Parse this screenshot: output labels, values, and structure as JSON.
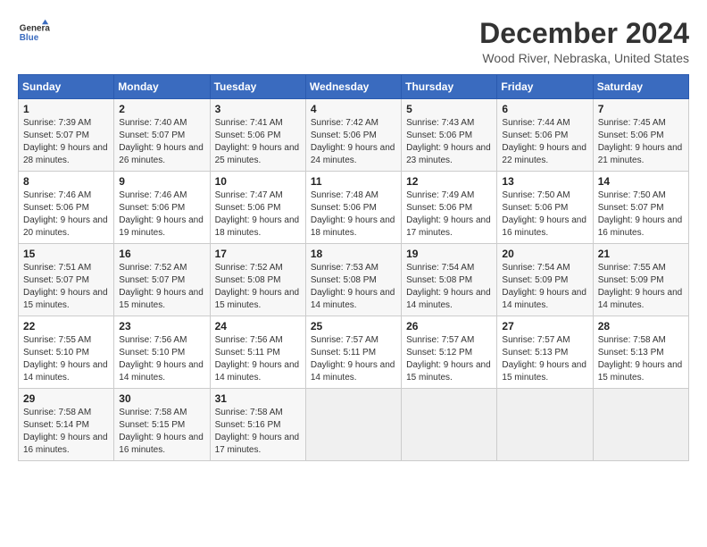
{
  "header": {
    "logo_line1": "General",
    "logo_line2": "Blue",
    "month": "December 2024",
    "location": "Wood River, Nebraska, United States"
  },
  "days_of_week": [
    "Sunday",
    "Monday",
    "Tuesday",
    "Wednesday",
    "Thursday",
    "Friday",
    "Saturday"
  ],
  "weeks": [
    [
      {
        "day": "1",
        "sunrise": "7:39 AM",
        "sunset": "5:07 PM",
        "daylight": "9 hours and 28 minutes."
      },
      {
        "day": "2",
        "sunrise": "7:40 AM",
        "sunset": "5:07 PM",
        "daylight": "9 hours and 26 minutes."
      },
      {
        "day": "3",
        "sunrise": "7:41 AM",
        "sunset": "5:06 PM",
        "daylight": "9 hours and 25 minutes."
      },
      {
        "day": "4",
        "sunrise": "7:42 AM",
        "sunset": "5:06 PM",
        "daylight": "9 hours and 24 minutes."
      },
      {
        "day": "5",
        "sunrise": "7:43 AM",
        "sunset": "5:06 PM",
        "daylight": "9 hours and 23 minutes."
      },
      {
        "day": "6",
        "sunrise": "7:44 AM",
        "sunset": "5:06 PM",
        "daylight": "9 hours and 22 minutes."
      },
      {
        "day": "7",
        "sunrise": "7:45 AM",
        "sunset": "5:06 PM",
        "daylight": "9 hours and 21 minutes."
      }
    ],
    [
      {
        "day": "8",
        "sunrise": "7:46 AM",
        "sunset": "5:06 PM",
        "daylight": "9 hours and 20 minutes."
      },
      {
        "day": "9",
        "sunrise": "7:46 AM",
        "sunset": "5:06 PM",
        "daylight": "9 hours and 19 minutes."
      },
      {
        "day": "10",
        "sunrise": "7:47 AM",
        "sunset": "5:06 PM",
        "daylight": "9 hours and 18 minutes."
      },
      {
        "day": "11",
        "sunrise": "7:48 AM",
        "sunset": "5:06 PM",
        "daylight": "9 hours and 18 minutes."
      },
      {
        "day": "12",
        "sunrise": "7:49 AM",
        "sunset": "5:06 PM",
        "daylight": "9 hours and 17 minutes."
      },
      {
        "day": "13",
        "sunrise": "7:50 AM",
        "sunset": "5:06 PM",
        "daylight": "9 hours and 16 minutes."
      },
      {
        "day": "14",
        "sunrise": "7:50 AM",
        "sunset": "5:07 PM",
        "daylight": "9 hours and 16 minutes."
      }
    ],
    [
      {
        "day": "15",
        "sunrise": "7:51 AM",
        "sunset": "5:07 PM",
        "daylight": "9 hours and 15 minutes."
      },
      {
        "day": "16",
        "sunrise": "7:52 AM",
        "sunset": "5:07 PM",
        "daylight": "9 hours and 15 minutes."
      },
      {
        "day": "17",
        "sunrise": "7:52 AM",
        "sunset": "5:08 PM",
        "daylight": "9 hours and 15 minutes."
      },
      {
        "day": "18",
        "sunrise": "7:53 AM",
        "sunset": "5:08 PM",
        "daylight": "9 hours and 14 minutes."
      },
      {
        "day": "19",
        "sunrise": "7:54 AM",
        "sunset": "5:08 PM",
        "daylight": "9 hours and 14 minutes."
      },
      {
        "day": "20",
        "sunrise": "7:54 AM",
        "sunset": "5:09 PM",
        "daylight": "9 hours and 14 minutes."
      },
      {
        "day": "21",
        "sunrise": "7:55 AM",
        "sunset": "5:09 PM",
        "daylight": "9 hours and 14 minutes."
      }
    ],
    [
      {
        "day": "22",
        "sunrise": "7:55 AM",
        "sunset": "5:10 PM",
        "daylight": "9 hours and 14 minutes."
      },
      {
        "day": "23",
        "sunrise": "7:56 AM",
        "sunset": "5:10 PM",
        "daylight": "9 hours and 14 minutes."
      },
      {
        "day": "24",
        "sunrise": "7:56 AM",
        "sunset": "5:11 PM",
        "daylight": "9 hours and 14 minutes."
      },
      {
        "day": "25",
        "sunrise": "7:57 AM",
        "sunset": "5:11 PM",
        "daylight": "9 hours and 14 minutes."
      },
      {
        "day": "26",
        "sunrise": "7:57 AM",
        "sunset": "5:12 PM",
        "daylight": "9 hours and 15 minutes."
      },
      {
        "day": "27",
        "sunrise": "7:57 AM",
        "sunset": "5:13 PM",
        "daylight": "9 hours and 15 minutes."
      },
      {
        "day": "28",
        "sunrise": "7:58 AM",
        "sunset": "5:13 PM",
        "daylight": "9 hours and 15 minutes."
      }
    ],
    [
      {
        "day": "29",
        "sunrise": "7:58 AM",
        "sunset": "5:14 PM",
        "daylight": "9 hours and 16 minutes."
      },
      {
        "day": "30",
        "sunrise": "7:58 AM",
        "sunset": "5:15 PM",
        "daylight": "9 hours and 16 minutes."
      },
      {
        "day": "31",
        "sunrise": "7:58 AM",
        "sunset": "5:16 PM",
        "daylight": "9 hours and 17 minutes."
      },
      null,
      null,
      null,
      null
    ]
  ],
  "labels": {
    "sunrise": "Sunrise:",
    "sunset": "Sunset:",
    "daylight": "Daylight:"
  }
}
